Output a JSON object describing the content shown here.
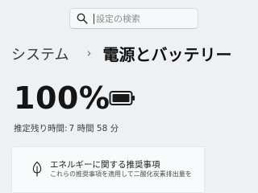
{
  "search": {
    "placeholder": "設定の検索"
  },
  "breadcrumb": {
    "parent": "システム",
    "separator": "›",
    "current": "電源とバッテリー"
  },
  "battery": {
    "percent_text": "100%",
    "level": 1.0,
    "remaining_label": "推定残り時間:",
    "remaining_value": "7 時間 58 分"
  },
  "recommendations": {
    "title": "エネルギーに関する推奨事項",
    "description": "これらの推奨事項を適用して二酸化炭素排出量を"
  },
  "colors": {
    "background": "#eef1f4",
    "card": "#f9fafb",
    "text": "#1b1b1b"
  },
  "icons": {
    "search": "search-icon",
    "battery": "battery-icon",
    "recommendations": "leaf-icon"
  }
}
